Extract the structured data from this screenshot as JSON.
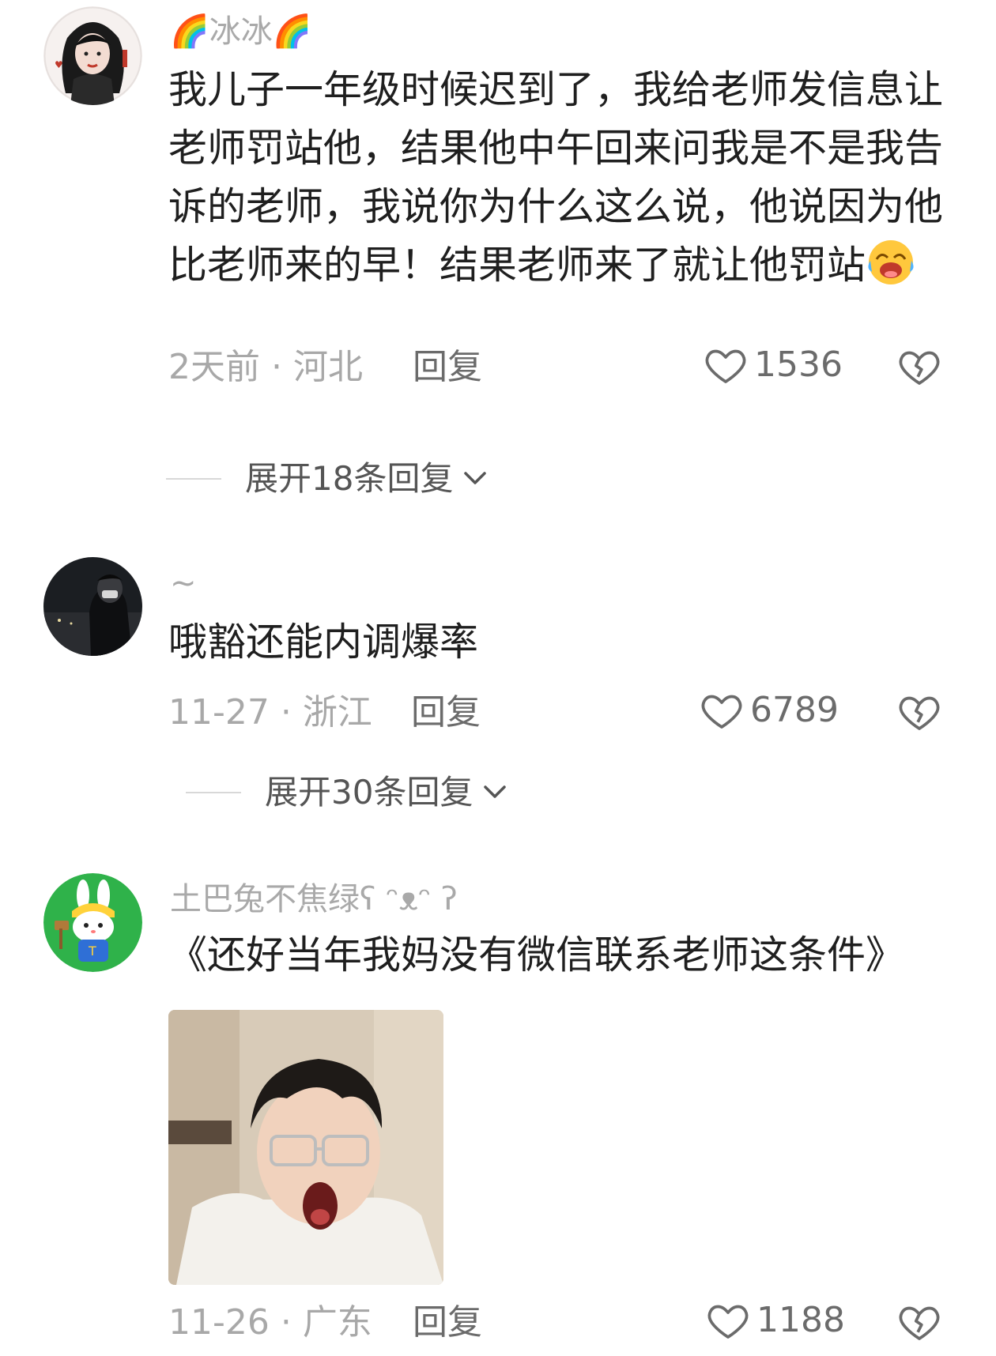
{
  "comments": [
    {
      "username": "🌈冰冰🌈",
      "content": "我儿子一年级时候迟到了，我给老师发信息让老师罚站他，结果他中午回来问我是不是我告诉的老师，我说你为什么这么说，他说因为他比老师来的早！结果老师来了就让他罚站",
      "time_location": "2天前 · 河北",
      "reply_label": "回复",
      "likes": "1536",
      "expand_label": "展开18条回复",
      "avatar_icon": "avatar-girl-illustration"
    },
    {
      "username": "~",
      "content": "哦豁还能内调爆率",
      "time_location": "11-27 · 浙江",
      "reply_label": "回复",
      "likes": "6789",
      "expand_label": "展开30条回复",
      "avatar_icon": "avatar-night-photo"
    },
    {
      "username": "土巴兔不焦绿ʕ ᵔᴥᵔ ʔ",
      "content": "《还好当年我妈没有微信联系老师这条件》",
      "time_location": "11-26 · 广东",
      "reply_label": "回复",
      "likes": "1188",
      "avatar_icon": "avatar-rabbit-mascot",
      "image_icon": "screaming-person-photo"
    }
  ],
  "colors": {
    "text": "#1f1f1f",
    "muted": "#a8a8a8",
    "secondary": "#6b6b6b"
  }
}
